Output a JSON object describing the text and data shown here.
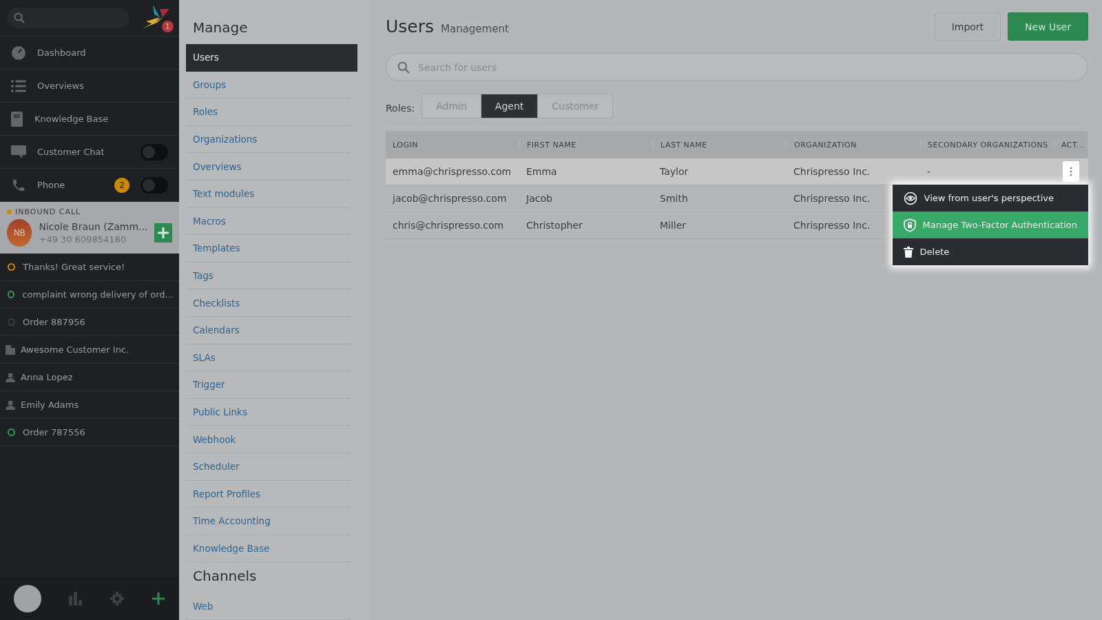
{
  "sidebar": {
    "logo_badge": "1",
    "nav": [
      {
        "label": "Dashboard",
        "kind": "link"
      },
      {
        "label": "Overviews",
        "kind": "link"
      },
      {
        "label": "Knowledge Base",
        "kind": "link"
      },
      {
        "label": "Customer Chat",
        "kind": "toggle",
        "on": false
      },
      {
        "label": "Phone",
        "kind": "toggle",
        "on": false,
        "badge": "2"
      }
    ],
    "inbound_call": {
      "label": "INBOUND CALL",
      "initials": "NB",
      "name": "Nicole Braun (Zamm...",
      "phone": "+49 30 609854180"
    },
    "tasks": [
      {
        "label": "Thanks! Great service!",
        "kind": "ticket",
        "color": "#c98a00"
      },
      {
        "label": "complaint wrong delivery of ord...",
        "kind": "ticket",
        "color": "#2f9a55"
      },
      {
        "label": "Order 887956",
        "kind": "ticket",
        "color": "#3a3c41"
      },
      {
        "label": "Awesome Customer Inc.",
        "kind": "organization"
      },
      {
        "label": "Anna Lopez",
        "kind": "user"
      },
      {
        "label": "Emily Adams",
        "kind": "user"
      },
      {
        "label": "Order 787556",
        "kind": "ticket",
        "color": "#2f9a55"
      }
    ]
  },
  "manage": [
    {
      "title": "Manage",
      "items": [
        {
          "label": "Users",
          "selected": true
        },
        {
          "label": "Groups",
          "selected": false
        },
        {
          "label": "Roles",
          "selected": false
        },
        {
          "label": "Organizations",
          "selected": false
        },
        {
          "label": "Overviews",
          "selected": false
        },
        {
          "label": "Text modules",
          "selected": false
        },
        {
          "label": "Macros",
          "selected": false
        },
        {
          "label": "Templates",
          "selected": false
        },
        {
          "label": "Tags",
          "selected": false
        },
        {
          "label": "Checklists",
          "selected": false
        },
        {
          "label": "Calendars",
          "selected": false
        },
        {
          "label": "SLAs",
          "selected": false
        },
        {
          "label": "Trigger",
          "selected": false
        },
        {
          "label": "Public Links",
          "selected": false
        },
        {
          "label": "Webhook",
          "selected": false
        },
        {
          "label": "Scheduler",
          "selected": false
        },
        {
          "label": "Report Profiles",
          "selected": false
        },
        {
          "label": "Time Accounting",
          "selected": false
        },
        {
          "label": "Knowledge Base",
          "selected": false
        }
      ]
    },
    {
      "title": "Channels",
      "items": [
        {
          "label": "Web",
          "selected": false
        }
      ]
    }
  ],
  "main": {
    "title": "Users",
    "subtitle": "Management",
    "buttons": [
      {
        "label": "Import",
        "kind": "secondary"
      },
      {
        "label": "New User",
        "kind": "primary"
      }
    ],
    "search": {
      "placeholder": "Search for users"
    },
    "roles": {
      "label": "Roles:",
      "tabs": [
        {
          "label": "Admin",
          "selected": false
        },
        {
          "label": "Agent",
          "selected": true
        },
        {
          "label": "Customer",
          "selected": false
        }
      ]
    },
    "table": {
      "columns": [
        "LOGIN",
        "FIRST NAME",
        "LAST NAME",
        "ORGANIZATION",
        "SECONDARY ORGANIZATIONS",
        "ACT..."
      ],
      "rows": [
        {
          "cells": [
            "emma@chrispresso.com",
            "Emma",
            "Taylor",
            "Chrispresso Inc.",
            "-"
          ],
          "selected": true
        },
        {
          "cells": [
            "jacob@chrispresso.com",
            "Jacob",
            "Smith",
            "Chrispresso Inc."
          ],
          "selected": false
        },
        {
          "cells": [
            "chris@chrispresso.com",
            "Christopher",
            "Miller",
            "Chrispresso Inc."
          ],
          "selected": false
        }
      ]
    },
    "action_menu": [
      {
        "label": "View from user's perspective",
        "kind": "view",
        "selected": false
      },
      {
        "label": "Manage Two-Factor Authentication",
        "kind": "shield",
        "selected": true
      },
      {
        "label": "Delete",
        "kind": "trash",
        "selected": false
      }
    ]
  }
}
